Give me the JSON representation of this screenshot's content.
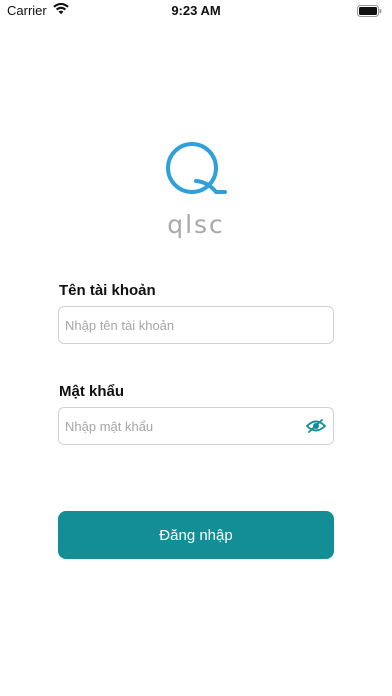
{
  "status_bar": {
    "carrier": "Carrier",
    "time": "9:23 AM",
    "icons": [
      "wifi-icon",
      "battery-icon"
    ]
  },
  "logo": {
    "text": "qlsc",
    "icon": "q-logo-icon"
  },
  "form": {
    "username_label": "Tên tài khoản",
    "username_placeholder": "Nhập tên tài khoản",
    "username_value": "",
    "password_label": "Mật khẩu",
    "password_placeholder": "Nhập mật khẩu",
    "password_value": "",
    "password_toggle_icon": "eye-icon",
    "submit_label": "Đăng nhập"
  },
  "colors": {
    "primary": "#138e96",
    "logo_blue": "#2ea0da",
    "logo_text": "#a9a9a9",
    "input_border": "#d2d2d2",
    "placeholder": "#a6a6a6"
  }
}
